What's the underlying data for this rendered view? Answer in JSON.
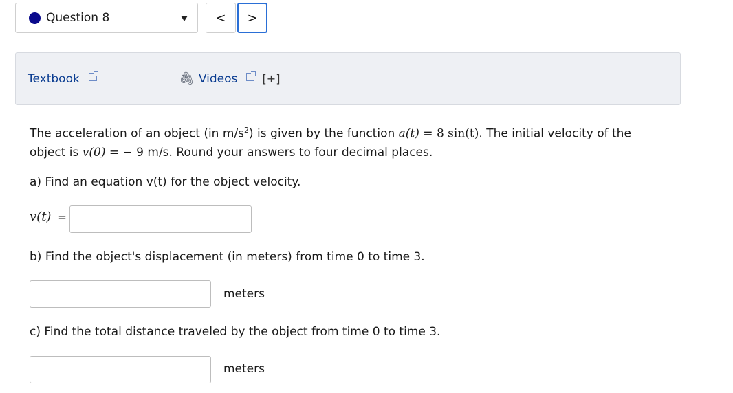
{
  "nav": {
    "question_label": "Question 8",
    "prev_symbol": "<",
    "next_symbol": ">"
  },
  "resources": {
    "textbook_label": "Textbook",
    "videos_label": "Videos",
    "expand_label": "[+]"
  },
  "question": {
    "intro_1": "The acceleration of an object (in m/s",
    "intro_exp": "2",
    "intro_2": ") is given by the function ",
    "a_func": "a(t)",
    "eq": " = ",
    "a_expr": "8 sin(t)",
    "intro_3": ". The initial velocity of the",
    "intro_4": "object is ",
    "v0": "v(0)",
    "v0_val": " − 9 m/s. Round your answers to four decimal places.",
    "part_a": "a) Find an equation v(t) for the object velocity.",
    "vt_label": "v(t)",
    "vt_eq": "=",
    "part_b": "b) Find the object's displacement (in meters) from time 0 to time 3.",
    "unit_b": "meters",
    "part_c": "c) Find the total distance traveled by the object from time 0 to time 3.",
    "unit_c": "meters"
  },
  "colors": {
    "question_dot": "#0a0a8c",
    "link": "#0b3d91",
    "active_border": "#2a6fd6",
    "panel_bg": "#eef0f4"
  }
}
